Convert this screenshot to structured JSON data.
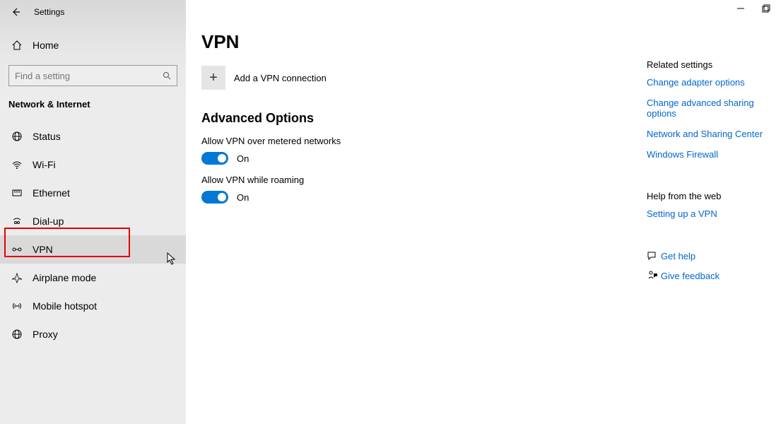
{
  "title": "Settings",
  "home_label": "Home",
  "search_placeholder": "Find a setting",
  "category": "Network & Internet",
  "nav": [
    {
      "icon": "status",
      "label": "Status"
    },
    {
      "icon": "wifi",
      "label": "Wi-Fi"
    },
    {
      "icon": "ethernet",
      "label": "Ethernet"
    },
    {
      "icon": "dialup",
      "label": "Dial-up"
    },
    {
      "icon": "vpn",
      "label": "VPN",
      "selected": true
    },
    {
      "icon": "airplane",
      "label": "Airplane mode"
    },
    {
      "icon": "hotspot",
      "label": "Mobile hotspot"
    },
    {
      "icon": "proxy",
      "label": "Proxy"
    }
  ],
  "page": {
    "title": "VPN",
    "add_label": "Add a VPN connection",
    "section": "Advanced Options",
    "opt1_label": "Allow VPN over metered networks",
    "opt1_state": "On",
    "opt2_label": "Allow VPN while roaming",
    "opt2_state": "On"
  },
  "right": {
    "related_header": "Related settings",
    "links": [
      "Change adapter options",
      "Change advanced sharing options",
      "Network and Sharing Center",
      "Windows Firewall"
    ],
    "help_header": "Help from the web",
    "help_links": [
      "Setting up a VPN"
    ],
    "get_help": "Get help",
    "give_feedback": "Give feedback"
  }
}
